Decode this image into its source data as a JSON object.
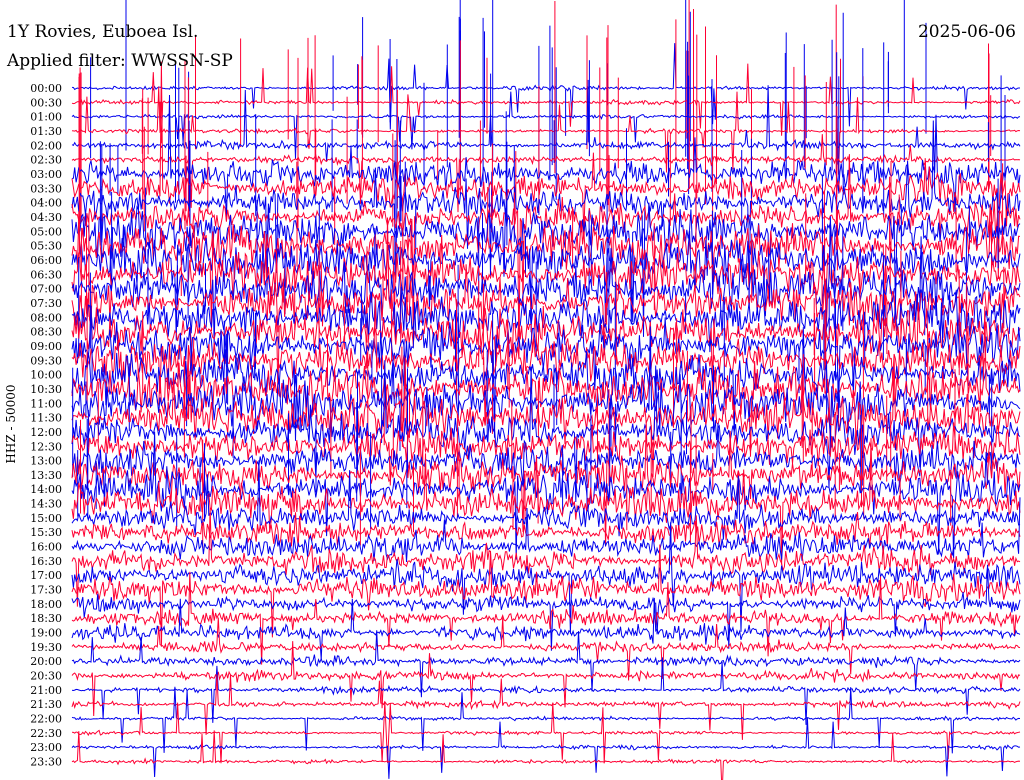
{
  "header": {
    "station": "1Y Rovies, Euboea Isl.",
    "date": "2025-06-06",
    "filter": "Applied filter: WWSSN-SP"
  },
  "colors": {
    "trace_a": "#0000ee",
    "trace_b": "#ff0033",
    "background": "#ffffff"
  },
  "chart_data": {
    "type": "line",
    "title": "1Y Rovies, Euboea Isl.",
    "ylabel": "HHZ - 50000",
    "date": "2025-06-06",
    "filter": "WWSSN-SP",
    "row_labels": [
      "00:00",
      "00:30",
      "01:00",
      "01:30",
      "02:00",
      "02:30",
      "03:00",
      "03:30",
      "04:00",
      "04:30",
      "05:00",
      "05:30",
      "06:00",
      "06:30",
      "07:00",
      "07:30",
      "08:00",
      "08:30",
      "09:00",
      "09:30",
      "10:00",
      "10:30",
      "11:00",
      "11:30",
      "12:00",
      "12:30",
      "13:00",
      "13:30",
      "14:00",
      "14:30",
      "15:00",
      "15:30",
      "16:00",
      "16:30",
      "17:00",
      "17:30",
      "18:00",
      "18:30",
      "19:00",
      "19:30",
      "20:00",
      "20:30",
      "21:00",
      "21:30",
      "22:00",
      "22:30",
      "23:00",
      "23:30"
    ],
    "series": [
      {
        "color": "#0000ee"
      },
      {
        "color": "#ff0033"
      }
    ],
    "grid": false
  }
}
